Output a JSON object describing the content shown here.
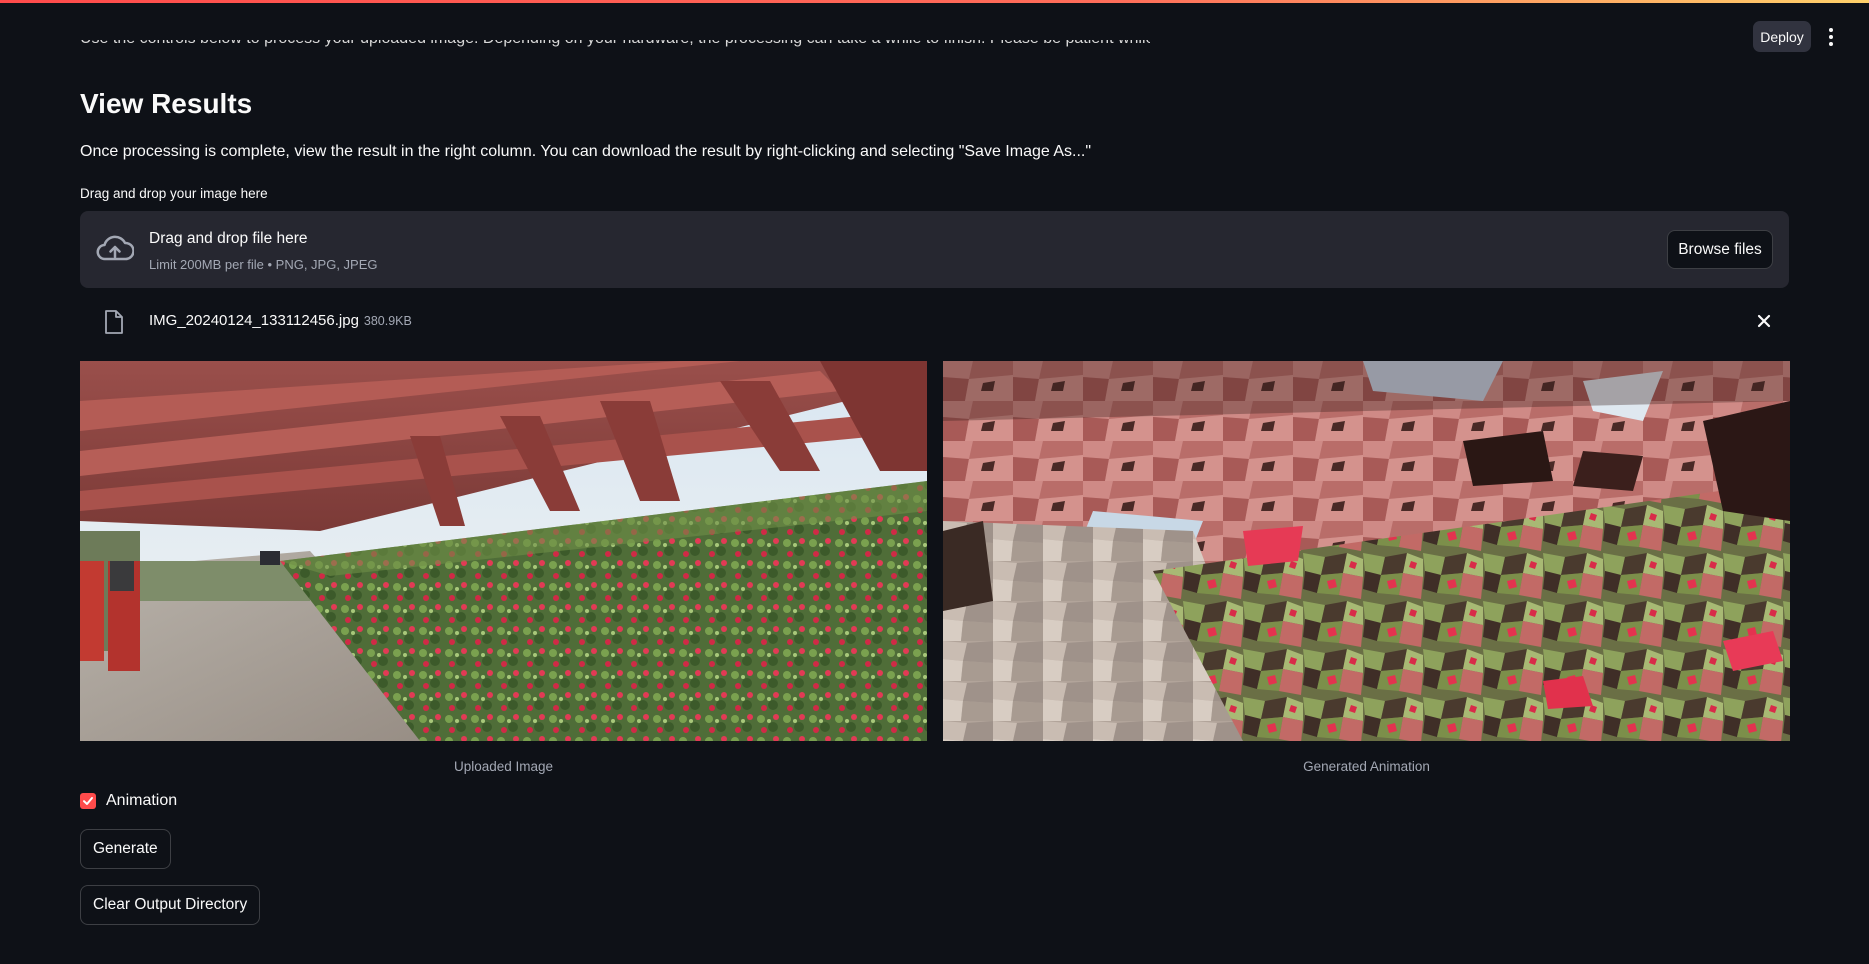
{
  "header": {
    "deploy_label": "Deploy",
    "menu_icon": "vertical-dots-icon"
  },
  "main": {
    "cut_off_text": "Use the controls below to process your uploaded image. Depending on your hardware, the processing can take a while to finish. Please be patient while it runs.",
    "heading": "View Results",
    "description": "Once processing is complete, view the result in the right column. You can download the result by right-clicking and selecting \"Save Image As...\""
  },
  "uploader": {
    "label": "Drag and drop your image here",
    "drop_title": "Drag and drop file here",
    "limit_text": "Limit 200MB per file • PNG, JPG, JPEG",
    "browse_label": "Browse files",
    "icon": "cloud-upload-icon"
  },
  "uploaded_file": {
    "name": "IMG_20240124_133112456.jpg",
    "size": "380.9KB",
    "icon": "file-icon",
    "remove_icon": "close-icon"
  },
  "images": {
    "left_caption": "Uploaded Image",
    "right_caption": "Generated Animation"
  },
  "controls": {
    "animation_label": "Animation",
    "animation_checked": true,
    "generate_label": "Generate",
    "clear_label": "Clear Output Directory"
  },
  "colors": {
    "background": "#0e1117",
    "accent": "#ff4b4b",
    "dropzone": "#262730",
    "muted_text": "#a3a8b4"
  }
}
